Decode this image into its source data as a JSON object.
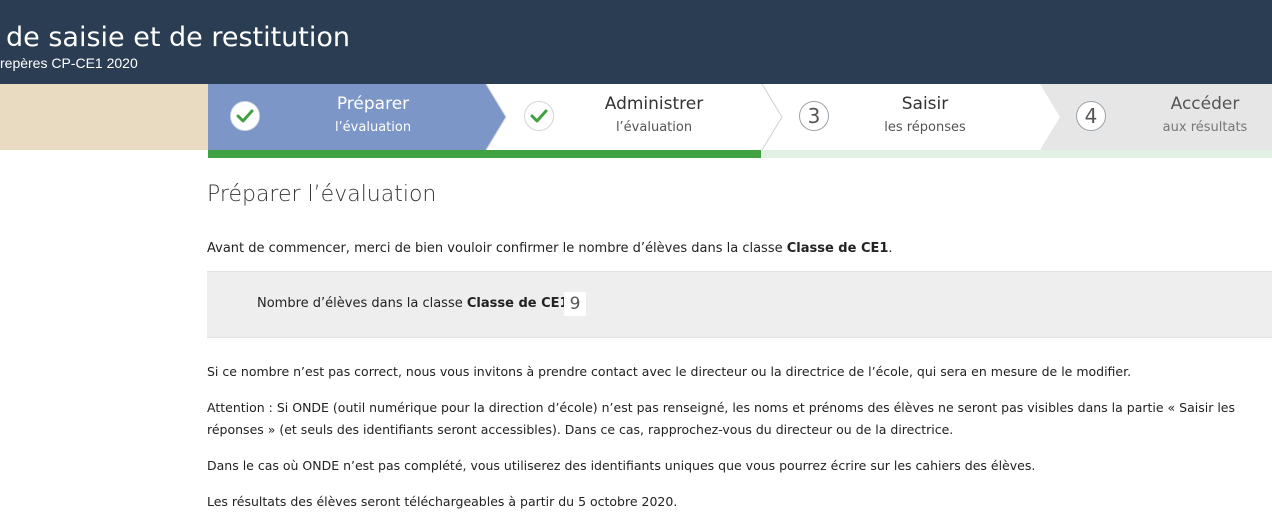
{
  "header": {
    "title": "de saisie et de restitution",
    "subtitle": "repères CP-CE1 2020"
  },
  "stepper": {
    "steps": [
      {
        "number": "",
        "main": "Préparer",
        "sub": "l’évaluation",
        "state": "done-active"
      },
      {
        "number": "",
        "main": "Administrer",
        "sub": "l’évaluation",
        "state": "done"
      },
      {
        "number": "3",
        "main": "Saisir",
        "sub": "les réponses",
        "state": "todo"
      },
      {
        "number": "4",
        "main": "Accéder",
        "sub": "aux résultats",
        "state": "todo"
      }
    ],
    "progress_fraction": 0.52
  },
  "colors": {
    "header_bg": "#2a3d53",
    "active_step": "#7b96c7",
    "inactive_step": "#e6e6e6",
    "progress": "#3fa142",
    "check": "#3fa142",
    "beige": "#e8dbc2"
  },
  "main": {
    "title": "Préparer l’évaluation",
    "intro_prefix": "Avant de commencer, merci de bien vouloir confirmer le nombre d’élèves dans la classe ",
    "intro_class": "Classe de CE1",
    "intro_suffix": ".",
    "count_label_prefix": "Nombre d’élèves dans la classe ",
    "count_label_class": "Classe de CE1",
    "count_label_suffix": " :",
    "count_value": "9",
    "para1": "Si ce nombre n’est pas correct, nous vous invitons à prendre contact avec le directeur ou la directrice de l’école, qui sera en mesure de le modifier.",
    "para2": "Attention : Si ONDE (outil numérique pour la direction d’école) n’est pas renseigné, les noms et prénoms des élèves ne seront pas visibles dans la partie « Saisir les réponses » (et seuls des identifiants seront accessibles). Dans ce cas, rapprochez-vous du directeur ou de la directrice.",
    "para3": "Dans le cas où ONDE n’est pas complété, vous utiliserez des identifiants uniques que vous pourrez écrire sur les cahiers des élèves.",
    "para4": "Les résultats des élèves seront téléchargeables à partir du 5 octobre 2020."
  }
}
